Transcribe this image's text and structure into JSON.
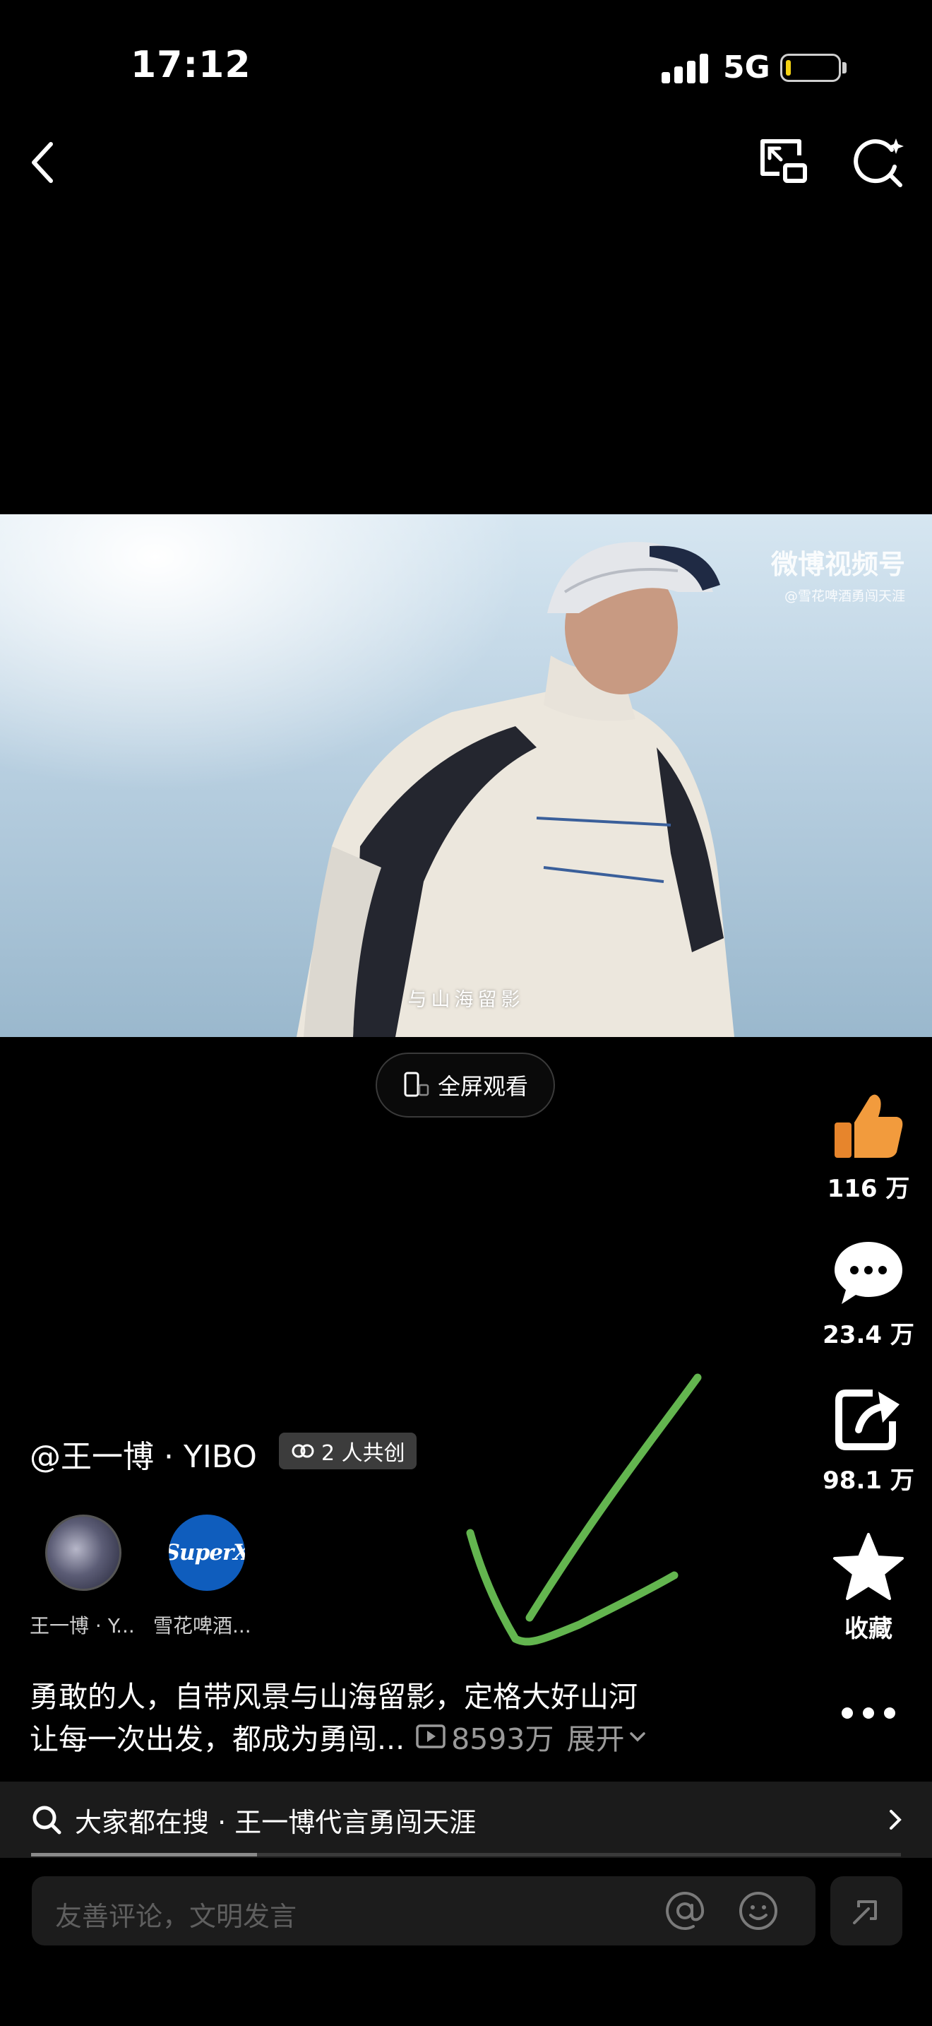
{
  "status_bar": {
    "time": "17:12",
    "network": "5G",
    "battery_level_pct": 10
  },
  "video": {
    "watermark_title": "微博视频号",
    "watermark_sub": "@雪花啤酒勇闯天涯",
    "subtitle": "与山海留影"
  },
  "fullscreen_label": "全屏观看",
  "actions": {
    "like_count": "116 万",
    "comment_count": "23.4 万",
    "share_count": "98.1 万",
    "favorite_label": "收藏"
  },
  "author": {
    "name": "@王一博 · YIBO",
    "collab_label": "2 人共创",
    "collaborators": [
      {
        "label": "王一博 · Y..."
      },
      {
        "label": "雪花啤酒...",
        "logo_text": "SuperX"
      }
    ]
  },
  "description": {
    "line1": "勇敢的人，自带风景与山海留影，定格大好山河",
    "line2": "让每一次出发，都成为勇闯...",
    "views": "8593万",
    "expand_label": "展开"
  },
  "hot_search": {
    "text": "大家都在搜 · 王一博代言勇闯天涯"
  },
  "playback_progress": 0.26,
  "comment": {
    "placeholder": "友善评论，文明发言"
  },
  "colors": {
    "like_orange": "#f29b3d",
    "annotation_green": "#63b54f"
  }
}
